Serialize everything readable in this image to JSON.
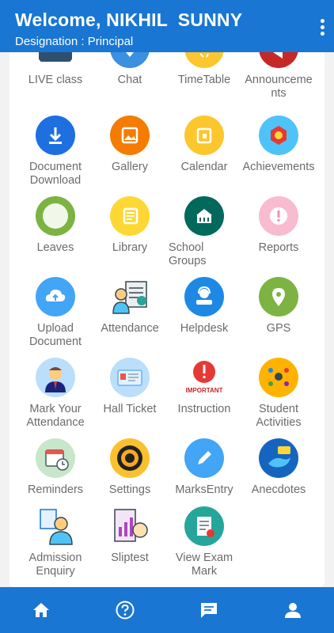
{
  "header": {
    "title": "Welcome, NIKHIL  SUNNY",
    "subtitle": "Designation : Principal"
  },
  "tiles": {
    "live_class": "LIVE class",
    "chat": "Chat",
    "timetable": "TimeTable",
    "announcements": "Announceme\nnts",
    "document_download": "Document\nDownload",
    "gallery": "Gallery",
    "calendar": "Calendar",
    "achievements": "Achievements",
    "leaves": "Leaves",
    "library": "Library",
    "school_groups": "School\nGroups",
    "reports": "Reports",
    "upload_document": "Upload\nDocument",
    "attendance": "Attendance",
    "helpdesk": "Helpdesk",
    "gps": "GPS",
    "mark_your_attendance": "Mark Your\nAttendance",
    "hall_ticket": "Hall Ticket",
    "instruction": "Instruction",
    "student_activities": "Student\nActivities",
    "reminders": "Reminders",
    "settings": "Settings",
    "marks_entry": "MarksEntry",
    "anecdotes": "Anecdotes",
    "admission_enquiry": "Admission\nEnquiry",
    "sliptest": "Sliptest",
    "view_exam_mark": "View Exam\nMark",
    "important_text": "IMPORTANT"
  },
  "colors": {
    "primary": "#1976d2",
    "label": "#6b6b6b"
  },
  "nav": [
    "home-icon",
    "help-icon",
    "chat-icon",
    "profile-icon"
  ]
}
